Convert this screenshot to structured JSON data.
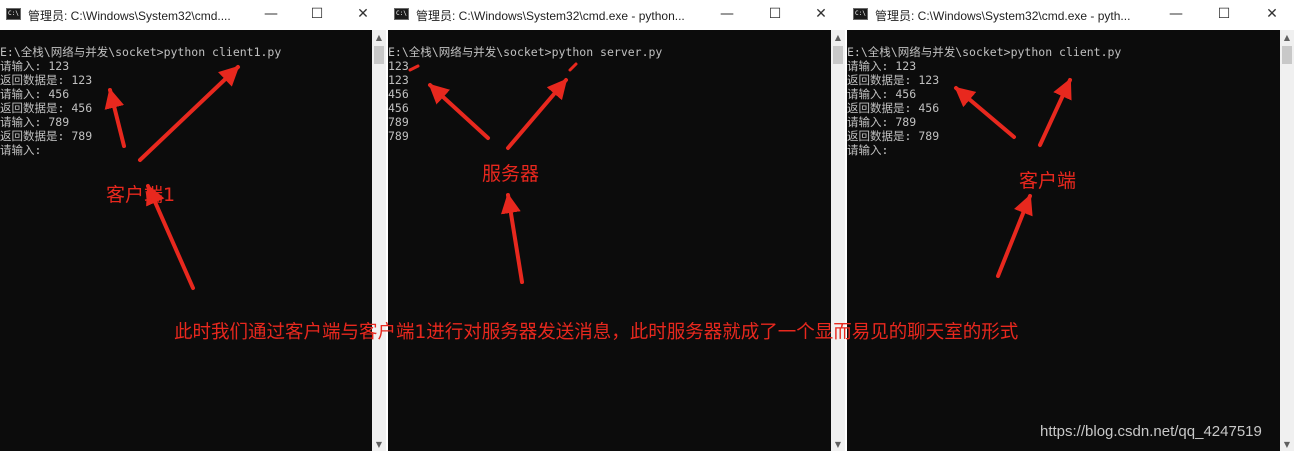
{
  "windows": [
    {
      "title": "管理员: C:\\Windows\\System32\\cmd....",
      "icon_text": "C:\\",
      "lines": [
        "E:\\全栈\\网络与并发\\socket>python client1.py",
        "请输入: 123",
        "返回数据是: 123",
        "请输入: 456",
        "返回数据是: 456",
        "请输入: 789",
        "返回数据是: 789",
        "请输入:"
      ]
    },
    {
      "title": "管理员: C:\\Windows\\System32\\cmd.exe - python...",
      "icon_text": "C:\\",
      "lines": [
        "E:\\全栈\\网络与并发\\socket>python server.py",
        "123",
        "123",
        "456",
        "456",
        "789",
        "789"
      ]
    },
    {
      "title": "管理员: C:\\Windows\\System32\\cmd.exe - pyth...",
      "icon_text": "C:\\",
      "lines": [
        "E:\\全栈\\网络与并发\\socket>python client.py",
        "请输入: 123",
        "返回数据是: 123",
        "请输入: 456",
        "返回数据是: 456",
        "请输入: 789",
        "返回数据是: 789",
        "请输入:"
      ]
    }
  ],
  "window_controls": {
    "minimize": "—",
    "maximize": "☐",
    "close": "✕"
  },
  "scrollbar": {
    "up": "▲",
    "down": "▼"
  },
  "annotations": {
    "client1": "客户端1",
    "server": "服务器",
    "client": "客户端",
    "caption": "此时我们通过客户端与客户端1进行对服务器发送消息，此时服务器就成了一个显而易见的聊天室的形式"
  },
  "watermark": "https://blog.csdn.net/qq_4247519",
  "colors": {
    "annotation": "#e8281e",
    "console_bg": "#0c0c0c",
    "console_text": "#c0c0c0"
  }
}
